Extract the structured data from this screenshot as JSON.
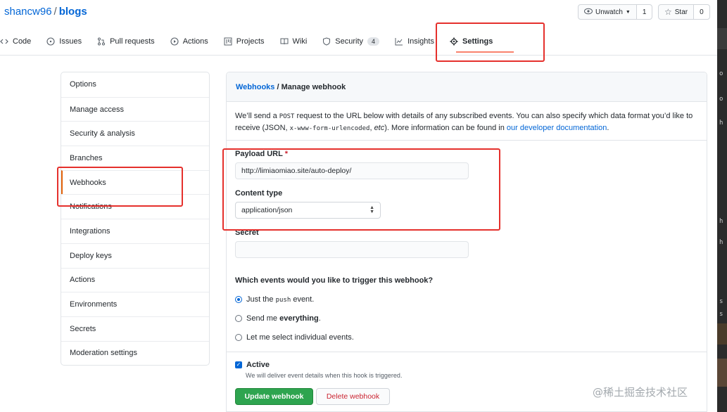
{
  "repo": {
    "owner": "shancw96",
    "separator": "/",
    "name": "blogs"
  },
  "actions": {
    "unwatch": {
      "label": "Unwatch",
      "count": "1"
    },
    "star": {
      "label": "Star",
      "count": "0"
    }
  },
  "tabs": [
    {
      "label": "Code",
      "icon": "code-icon"
    },
    {
      "label": "Issues",
      "icon": "issue-icon"
    },
    {
      "label": "Pull requests",
      "icon": "pull-request-icon"
    },
    {
      "label": "Actions",
      "icon": "play-icon"
    },
    {
      "label": "Projects",
      "icon": "project-icon"
    },
    {
      "label": "Wiki",
      "icon": "book-icon"
    },
    {
      "label": "Security",
      "icon": "shield-icon",
      "badge": "4"
    },
    {
      "label": "Insights",
      "icon": "graph-icon"
    },
    {
      "label": "Settings",
      "icon": "gear-icon",
      "active": true
    }
  ],
  "sidebar": {
    "items": [
      {
        "label": "Options"
      },
      {
        "label": "Manage access"
      },
      {
        "label": "Security & analysis"
      },
      {
        "label": "Branches"
      },
      {
        "label": "Webhooks",
        "selected": true
      },
      {
        "label": "Notifications"
      },
      {
        "label": "Integrations"
      },
      {
        "label": "Deploy keys"
      },
      {
        "label": "Actions"
      },
      {
        "label": "Environments"
      },
      {
        "label": "Secrets"
      },
      {
        "label": "Moderation settings"
      }
    ]
  },
  "panel": {
    "breadcrumb_link": "Webhooks",
    "breadcrumb_sep": " / ",
    "breadcrumb_current": "Manage webhook",
    "desc_1": "We’ll send a ",
    "desc_code_1": "POST",
    "desc_2": " request to the URL below with details of any subscribed events. You can also specify which data format you’d like to receive (JSON, ",
    "desc_code_2": "x-www-form-urlencoded",
    "desc_3": ", ",
    "desc_etc": "etc",
    "desc_4": "). More information can be found in ",
    "desc_link": "our developer documentation",
    "desc_5": "."
  },
  "form": {
    "payload_url_label": "Payload URL",
    "required_mark": "*",
    "payload_url_value": "http://limiaomiao.site/auto-deploy/",
    "content_type_label": "Content type",
    "content_type_value": "application/json",
    "secret_label": "Secret",
    "secret_value": "",
    "events_question": "Which events would you like to trigger this webhook?",
    "event_options": [
      {
        "before": "Just the ",
        "code": "push",
        "after": " event.",
        "selected": true
      },
      {
        "before": "Send me ",
        "bold": "everything",
        "after": ".",
        "selected": false
      },
      {
        "before": "Let me select individual events.",
        "selected": false
      }
    ],
    "active_label": "Active",
    "active_checked": true,
    "active_hint": "We will deliver event details when this hook is triggered.",
    "update_button": "Update webhook",
    "delete_button": "Delete webhook"
  },
  "right_edge_chars": [
    "o",
    "o",
    "h",
    "h",
    "h",
    "s",
    "s"
  ],
  "watermark": "@稀土掘金技术社区",
  "colors": {
    "link": "#0366d6",
    "annotation": "#e5302c",
    "primary_button": "#2ea44f",
    "danger_text": "#cb2431",
    "active_tab_underline": "#f9826c"
  }
}
